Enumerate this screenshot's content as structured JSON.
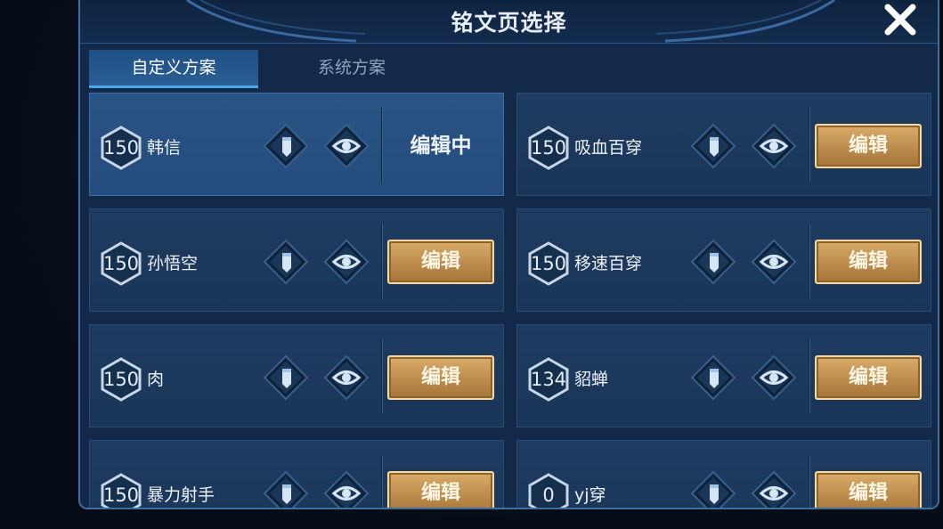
{
  "dialog": {
    "title": "铭文页选择"
  },
  "tabs": [
    {
      "label": "自定义方案",
      "active": true
    },
    {
      "label": "系统方案",
      "active": false
    }
  ],
  "pages": [
    {
      "level": "150",
      "name": "韩信",
      "action": "编辑中",
      "selected": true
    },
    {
      "level": "150",
      "name": "吸血百穿",
      "action": "编辑",
      "selected": false
    },
    {
      "level": "150",
      "name": "孙悟空",
      "action": "编辑",
      "selected": false
    },
    {
      "level": "150",
      "name": "移速百穿",
      "action": "编辑",
      "selected": false
    },
    {
      "level": "150",
      "name": "肉",
      "action": "编辑",
      "selected": false
    },
    {
      "level": "134",
      "name": "貂蝉",
      "action": "编辑",
      "selected": false
    },
    {
      "level": "150",
      "name": "暴力射手",
      "action": "编辑",
      "selected": false
    },
    {
      "level": "0",
      "name": "yj穿",
      "action": "编辑",
      "selected": false
    }
  ],
  "icons": {
    "close": "close-icon",
    "rename": "pencil-icon",
    "preview": "eye-icon",
    "level": "hexagon-badge"
  },
  "colors": {
    "accent": "#4aa8ec",
    "gold_button": "#c99a58",
    "panel": "#13294a"
  }
}
